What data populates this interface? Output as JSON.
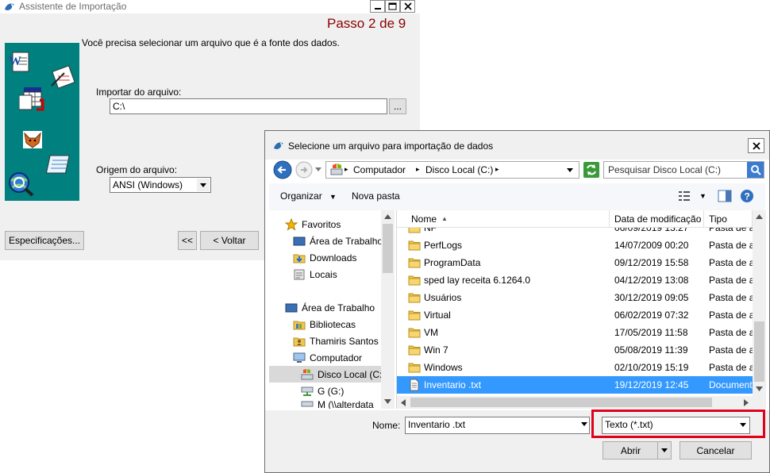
{
  "wizard": {
    "title": "Assistente de Importação",
    "step": "Passo 2 de 9",
    "instruction": "Você precisa selecionar um arquivo que é a fonte dos dados.",
    "import_label": "Importar do arquivo:",
    "import_value": "C:\\",
    "browse_label": "...",
    "origin_label": "Origem do arquivo:",
    "origin_value": "ANSI (Windows)",
    "specs_button": "Especificações...",
    "first_button": "<<",
    "back_button": "< Voltar"
  },
  "dialog": {
    "title": "Selecione um arquivo para importação de dados",
    "breadcrumb": [
      "Computador",
      "Disco Local (C:)"
    ],
    "search_placeholder": "Pesquisar Disco Local (C:)",
    "toolbar": {
      "organize": "Organizar",
      "new_folder": "Nova pasta"
    },
    "nav": {
      "favorites": "Favoritos",
      "desktop": "Área de Trabalho",
      "downloads": "Downloads",
      "places": "Locais",
      "desktop2": "Área de Trabalho",
      "libraries": "Bibliotecas",
      "user": "Thamiris Santos",
      "computer": "Computador",
      "local_disk": "Disco Local (C:)",
      "drive_g": "G (G:)",
      "drive_m": "M (\\\\alterdata"
    },
    "columns": {
      "name": "Nome",
      "date": "Data de modificação",
      "type": "Tipo"
    },
    "rows": [
      {
        "name": "NF",
        "date": "06/09/2019 13:27",
        "type": "Pasta de arquivos"
      },
      {
        "name": "PerfLogs",
        "date": "14/07/2009 00:20",
        "type": "Pasta de arquivos"
      },
      {
        "name": "ProgramData",
        "date": "09/12/2019 15:58",
        "type": "Pasta de arquivos"
      },
      {
        "name": "sped lay receita 6.1264.0",
        "date": "04/12/2019 13:08",
        "type": "Pasta de arquivos"
      },
      {
        "name": "Usuários",
        "date": "30/12/2019 09:05",
        "type": "Pasta de arquivos"
      },
      {
        "name": "Virtual",
        "date": "06/02/2019 07:32",
        "type": "Pasta de arquivos"
      },
      {
        "name": "VM",
        "date": "17/05/2019 11:58",
        "type": "Pasta de arquivos"
      },
      {
        "name": "Win 7",
        "date": "05/08/2019 11:39",
        "type": "Pasta de arquivos"
      },
      {
        "name": "Windows",
        "date": "02/10/2019 15:19",
        "type": "Pasta de arquivos"
      },
      {
        "name": "Inventario .txt",
        "date": "19/12/2019 12:45",
        "type": "Documento de Texto"
      }
    ],
    "filename_label": "Nome:",
    "filename_value": "Inventario .txt",
    "filter_value": "Texto (*.txt)",
    "open_button": "Abrir",
    "cancel_button": "Cancelar"
  },
  "colors": {
    "highlight_box": "#e0001b",
    "selection": "#3399ff",
    "wizard_panel": "#00807f",
    "step_text": "#8b0000"
  }
}
